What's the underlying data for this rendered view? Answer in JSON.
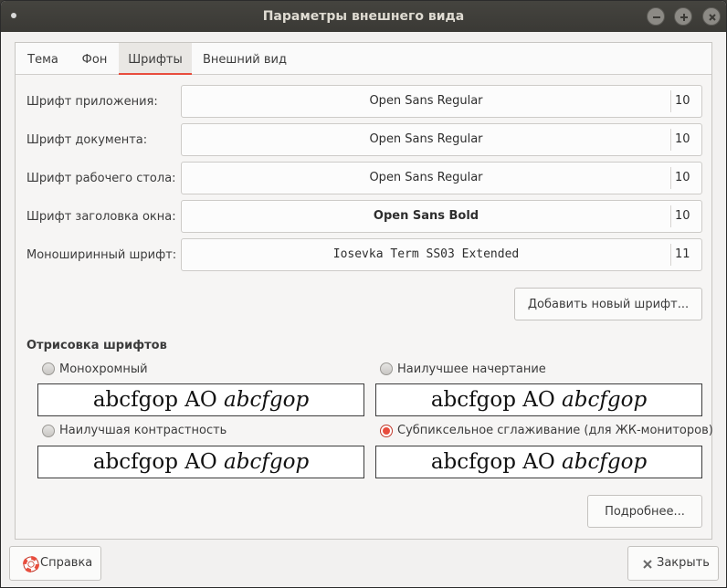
{
  "window": {
    "title": "Параметры внешнего вида"
  },
  "tabs": [
    {
      "label": "Тема",
      "active": false
    },
    {
      "label": "Фон",
      "active": false
    },
    {
      "label": "Шрифты",
      "active": true
    },
    {
      "label": "Внешний вид",
      "active": false
    }
  ],
  "fonts": [
    {
      "label": "Шрифт приложения:",
      "font": "Open Sans Regular",
      "size": "10"
    },
    {
      "label": "Шрифт документа:",
      "font": "Open Sans Regular",
      "size": "10"
    },
    {
      "label": "Шрифт рабочего стола:",
      "font": "Open Sans Regular",
      "size": "10"
    },
    {
      "label": "Шрифт заголовка окна:",
      "font": "Open Sans Bold",
      "size": "10"
    },
    {
      "label": "Моноширинный шрифт:",
      "font": "Iosevka Term SS03 Extended",
      "size": "11"
    }
  ],
  "add_font_button": "Добавить новый шрифт...",
  "rendering": {
    "title": "Отрисовка шрифтов",
    "sample_regular": "abcfgop AO",
    "sample_italic": "abcfgop",
    "options": [
      {
        "label": "Монохромный",
        "checked": false
      },
      {
        "label": "Наилучшее начертание",
        "checked": false
      },
      {
        "label": "Наилучшая контрастность",
        "checked": false
      },
      {
        "label": "Субпиксельное сглаживание (для ЖК-мониторов)",
        "checked": true
      }
    ]
  },
  "details_button": "Подробнее...",
  "footer": {
    "help_label": "Справка",
    "close_label": "Закрыть"
  },
  "colors": {
    "accent": "#e84d3d",
    "titlebar": "#3c3b37"
  }
}
